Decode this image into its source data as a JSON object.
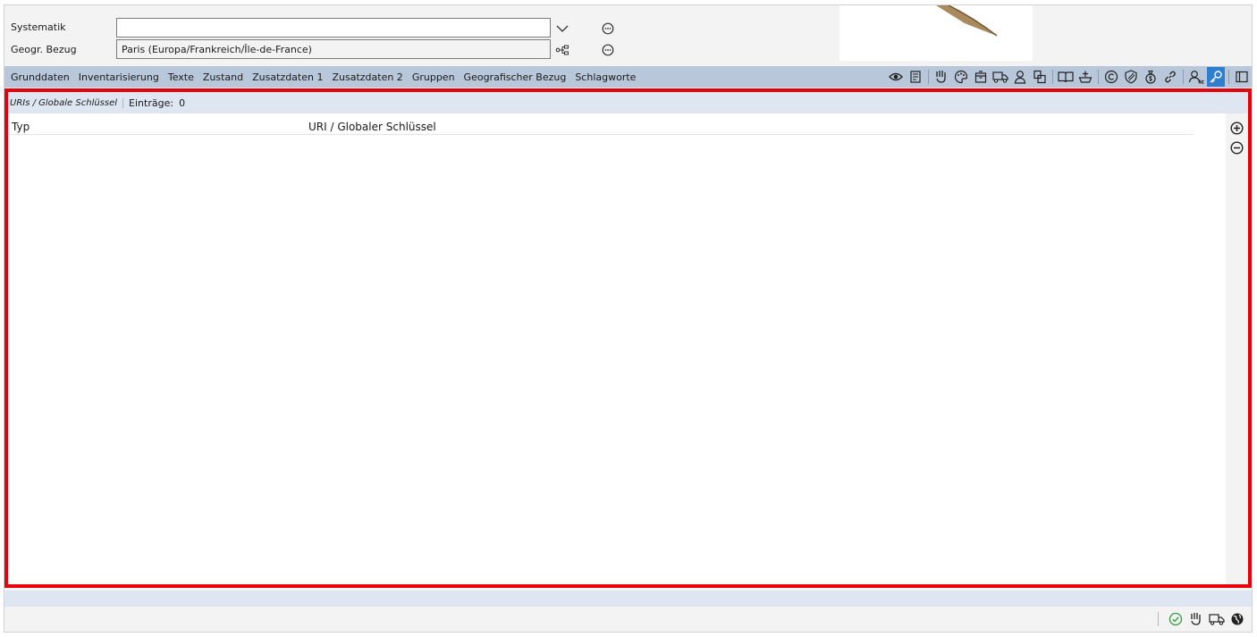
{
  "form": {
    "systematik_label": "Systematik",
    "systematik_value": "",
    "geo_label": "Geogr. Bezug",
    "geo_value": "Paris (Europa/Frankreich/Île-de-France)"
  },
  "tabs": [
    "Grunddaten",
    "Inventarisierung",
    "Texte",
    "Zustand",
    "Zusatzdaten 1",
    "Zusatzdaten 2",
    "Gruppen",
    "Geografischer Bezug",
    "Schlagworte"
  ],
  "toolbar_icons": [
    "eye-icon",
    "document-icon",
    "hand-icon",
    "palette-icon",
    "box-icon",
    "truck-icon",
    "person-icon",
    "copy-icon",
    "book-icon",
    "ship-icon",
    "copyright-icon",
    "shield-icon",
    "money-bag-icon",
    "link-icon",
    "person-abc-icon",
    "key-icon",
    "panel-icon"
  ],
  "panel": {
    "title": "URIs / Globale Schlüssel",
    "count_label": "Einträge:",
    "count_value": "0",
    "columns": [
      "Typ",
      "URI / Globaler Schlüssel"
    ]
  },
  "status_icons": [
    "check-circle-icon",
    "hand-icon",
    "truck-icon",
    "globe-icon"
  ],
  "colors": {
    "tabbar": "#b9c7da",
    "panel_header": "#dde6f1",
    "highlight": "#e8000b",
    "active_icon": "#2f7fd0",
    "success": "#2e9e3e"
  }
}
